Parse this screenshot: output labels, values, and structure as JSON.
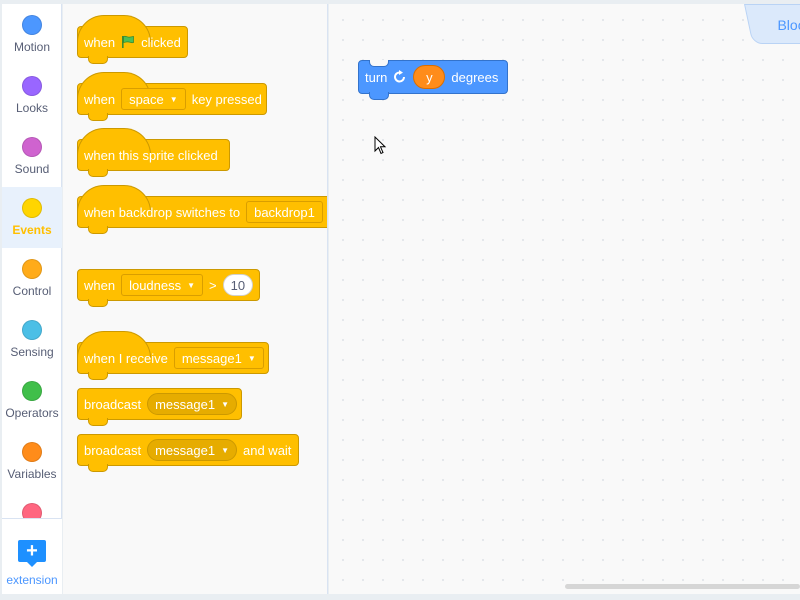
{
  "categories": [
    {
      "label": "Motion",
      "color": "#4c97ff",
      "selected": false
    },
    {
      "label": "Looks",
      "color": "#9966ff",
      "selected": false
    },
    {
      "label": "Sound",
      "color": "#cf63cf",
      "selected": false
    },
    {
      "label": "Events",
      "color": "#ffd500",
      "selected": true
    },
    {
      "label": "Control",
      "color": "#ffab19",
      "selected": false
    },
    {
      "label": "Sensing",
      "color": "#4cbfe6",
      "selected": false
    },
    {
      "label": "Operators",
      "color": "#40bf4a",
      "selected": false
    },
    {
      "label": "Variables",
      "color": "#ff8c1a",
      "selected": false
    },
    {
      "label": "",
      "color": "#ff6680",
      "selected": false
    }
  ],
  "extension_label": "extension",
  "flyout": {
    "flag_clicked": {
      "when": "when",
      "clicked": "clicked"
    },
    "key_pressed": {
      "when": "when",
      "key": "space",
      "rest": "key pressed"
    },
    "sprite_clicked": {
      "text": "when this sprite clicked"
    },
    "backdrop_switches": {
      "text": "when backdrop switches to",
      "backdrop": "backdrop1"
    },
    "loudness": {
      "when": "when",
      "sensor": "loudness",
      "op": ">",
      "value": "10"
    },
    "receive": {
      "text": "when I receive",
      "message": "message1"
    },
    "broadcast": {
      "text": "broadcast",
      "message": "message1"
    },
    "broadcast_wait": {
      "text": "broadcast",
      "message": "message1",
      "rest": "and wait"
    }
  },
  "workspace": {
    "tab_label": "Blocks",
    "turn_block": {
      "turn": "turn",
      "variable": "y",
      "degrees": "degrees"
    }
  },
  "colors": {
    "events": "#ffbf00",
    "motion": "#4c97ff",
    "variables": "#ff8c1a",
    "accent": "#4c97ff"
  }
}
